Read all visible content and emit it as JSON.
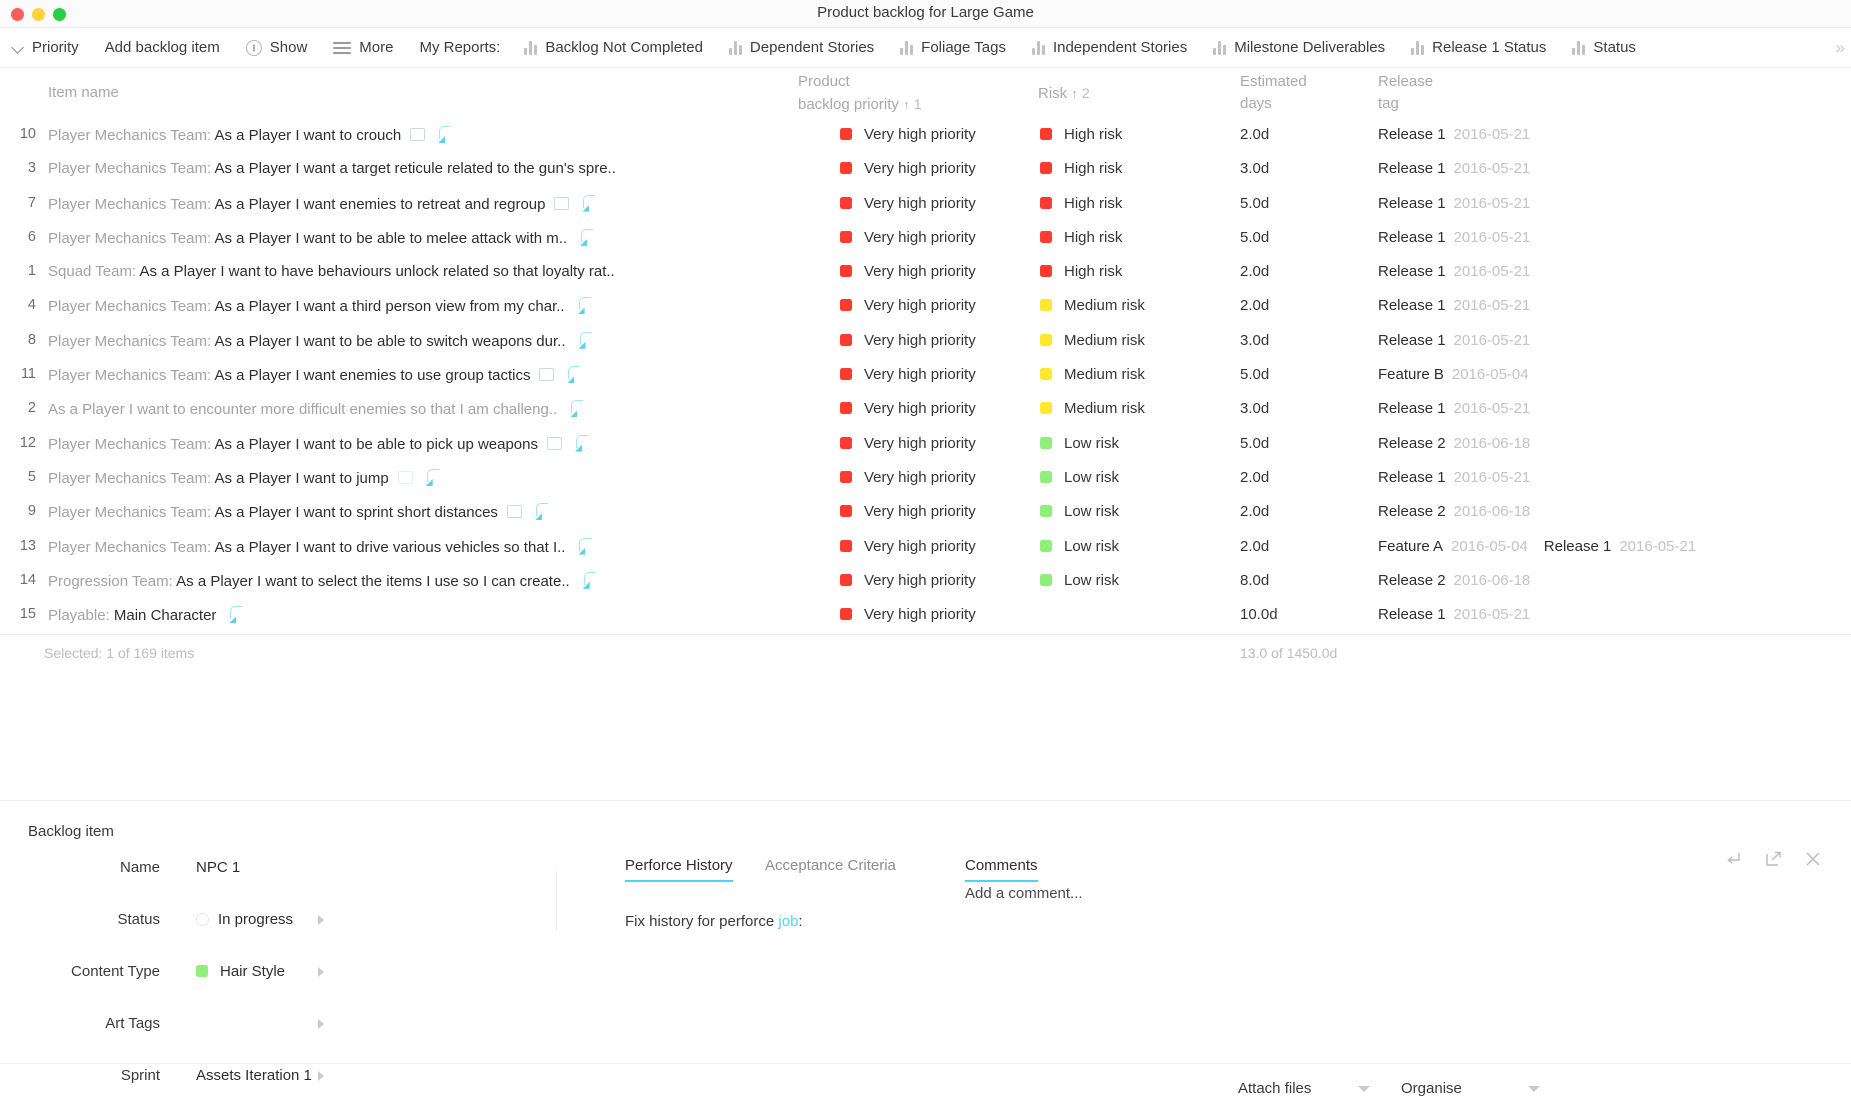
{
  "window": {
    "title": "Product backlog for Large Game",
    "traffic_lights": [
      "close",
      "minimize",
      "zoom"
    ]
  },
  "toolbar": {
    "priority_label": "Priority",
    "add_item_label": "Add backlog item",
    "show_label": "Show",
    "more_label": "More",
    "my_reports_label": "My Reports:",
    "reports": [
      "Backlog Not Completed",
      "Dependent Stories",
      "Foliage Tags",
      "Independent Stories",
      "Milestone Deliverables",
      "Release 1 Status",
      "Status"
    ],
    "overflow_label": "»"
  },
  "columns": {
    "item_name": "Item name",
    "priority_l1": "Product",
    "priority_l2": "backlog priority",
    "priority_sort": "1",
    "risk": "Risk",
    "risk_sort": "2",
    "estimated_l1": "Estimated",
    "estimated_l2": "days",
    "release_l1": "Release",
    "release_l2": "tag",
    "sort_arrow": "↑"
  },
  "colors": {
    "very_high_priority": "#ff3b2f",
    "high_risk": "#ff3b2f",
    "medium_risk": "#ffe92e",
    "low_risk": "#8ef07a",
    "accent": "#4fd3ef",
    "content_type": "#8ef07a"
  },
  "rows": [
    {
      "idx": "10",
      "team": "Player Mechanics Team:",
      "name": "As a Player I want to crouch",
      "doc": true,
      "link": true,
      "priority": "Very high priority",
      "priority_color": "#ff3b2f",
      "risk": "High risk",
      "risk_color": "#ff3b2f",
      "days": "2.0d",
      "releases": [
        {
          "tag": "Release 1",
          "date": "2016-05-21"
        }
      ]
    },
    {
      "idx": "3",
      "team": "Player Mechanics Team:",
      "name": "As a Player I want a target reticule related to the gun's spre..",
      "doc": false,
      "link": false,
      "priority": "Very high priority",
      "priority_color": "#ff3b2f",
      "risk": "High risk",
      "risk_color": "#ff3b2f",
      "days": "3.0d",
      "releases": [
        {
          "tag": "Release 1",
          "date": "2016-05-21"
        }
      ]
    },
    {
      "idx": "7",
      "team": "Player Mechanics Team:",
      "name": "As a Player I want enemies to retreat and regroup",
      "doc": true,
      "link": true,
      "priority": "Very high priority",
      "priority_color": "#ff3b2f",
      "risk": "High risk",
      "risk_color": "#ff3b2f",
      "days": "5.0d",
      "releases": [
        {
          "tag": "Release 1",
          "date": "2016-05-21"
        }
      ]
    },
    {
      "idx": "6",
      "team": "Player Mechanics Team:",
      "name": "As a Player I want to be able to melee attack with m..",
      "doc": false,
      "link": true,
      "priority": "Very high priority",
      "priority_color": "#ff3b2f",
      "risk": "High risk",
      "risk_color": "#ff3b2f",
      "days": "5.0d",
      "releases": [
        {
          "tag": "Release 1",
          "date": "2016-05-21"
        }
      ]
    },
    {
      "idx": "1",
      "team": "Squad Team:",
      "name": "As a Player I want to have behaviours unlock related so that loyalty rat..",
      "doc": false,
      "link": false,
      "priority": "Very high priority",
      "priority_color": "#ff3b2f",
      "risk": "High risk",
      "risk_color": "#ff3b2f",
      "days": "2.0d",
      "releases": [
        {
          "tag": "Release 1",
          "date": "2016-05-21"
        }
      ]
    },
    {
      "idx": "4",
      "team": "Player Mechanics Team:",
      "name": "As a Player I want a third person view from my char..",
      "doc": false,
      "link": true,
      "priority": "Very high priority",
      "priority_color": "#ff3b2f",
      "risk": "Medium risk",
      "risk_color": "#ffe92e",
      "days": "2.0d",
      "releases": [
        {
          "tag": "Release 1",
          "date": "2016-05-21"
        }
      ]
    },
    {
      "idx": "8",
      "team": "Player Mechanics Team:",
      "name": "As a Player I want to be able to switch weapons dur..",
      "doc": false,
      "link": true,
      "priority": "Very high priority",
      "priority_color": "#ff3b2f",
      "risk": "Medium risk",
      "risk_color": "#ffe92e",
      "days": "3.0d",
      "releases": [
        {
          "tag": "Release 1",
          "date": "2016-05-21"
        }
      ]
    },
    {
      "idx": "11",
      "team": "Player Mechanics Team:",
      "name": "As a Player I want enemies to use group tactics",
      "doc": true,
      "link": true,
      "priority": "Very high priority",
      "priority_color": "#ff3b2f",
      "risk": "Medium risk",
      "risk_color": "#ffe92e",
      "days": "5.0d",
      "releases": [
        {
          "tag": "Feature B",
          "date": "2016-05-04"
        }
      ]
    },
    {
      "idx": "2",
      "team": "",
      "name": "As a Player I want to encounter more difficult enemies so that I am challeng..",
      "doc": false,
      "link": true,
      "dim": true,
      "priority": "Very high priority",
      "priority_color": "#ff3b2f",
      "risk": "Medium risk",
      "risk_color": "#ffe92e",
      "days": "3.0d",
      "releases": [
        {
          "tag": "Release 1",
          "date": "2016-05-21"
        }
      ]
    },
    {
      "idx": "12",
      "team": "Player Mechanics Team:",
      "name": "As a Player I want to be able to pick up weapons",
      "doc": true,
      "link": true,
      "priority": "Very high priority",
      "priority_color": "#ff3b2f",
      "risk": "Low risk",
      "risk_color": "#8ef07a",
      "days": "5.0d",
      "releases": [
        {
          "tag": "Release 2",
          "date": "2016-06-18"
        }
      ]
    },
    {
      "idx": "5",
      "team": "Player Mechanics Team:",
      "name": "As a Player I want to jump",
      "doc": true,
      "doc_faint": true,
      "link": true,
      "priority": "Very high priority",
      "priority_color": "#ff3b2f",
      "risk": "Low risk",
      "risk_color": "#8ef07a",
      "days": "2.0d",
      "releases": [
        {
          "tag": "Release 1",
          "date": "2016-05-21"
        }
      ]
    },
    {
      "idx": "9",
      "team": "Player Mechanics Team:",
      "name": "As a Player I want to sprint short distances",
      "doc": true,
      "link": true,
      "priority": "Very high priority",
      "priority_color": "#ff3b2f",
      "risk": "Low risk",
      "risk_color": "#8ef07a",
      "days": "2.0d",
      "releases": [
        {
          "tag": "Release 2",
          "date": "2016-06-18"
        }
      ]
    },
    {
      "idx": "13",
      "team": "Player Mechanics Team:",
      "name": "As a Player I want to drive various vehicles so that I..",
      "doc": false,
      "link": true,
      "priority": "Very high priority",
      "priority_color": "#ff3b2f",
      "risk": "Low risk",
      "risk_color": "#8ef07a",
      "days": "2.0d",
      "releases": [
        {
          "tag": "Feature A",
          "date": "2016-05-04"
        },
        {
          "tag": "Release 1",
          "date": "2016-05-21"
        }
      ]
    },
    {
      "idx": "14",
      "team": "Progression Team:",
      "name": "As a Player I want to select the items I use so I can create..",
      "doc": false,
      "link": true,
      "priority": "Very high priority",
      "priority_color": "#ff3b2f",
      "risk": "Low risk",
      "risk_color": "#8ef07a",
      "days": "8.0d",
      "releases": [
        {
          "tag": "Release 2",
          "date": "2016-06-18"
        }
      ]
    },
    {
      "idx": "15",
      "team": "Playable:",
      "name": "Main Character",
      "doc": false,
      "link": true,
      "priority": "Very high priority",
      "priority_color": "#ff3b2f",
      "risk": "",
      "risk_color": "",
      "days": "10.0d",
      "releases": [
        {
          "tag": "Release 1",
          "date": "2016-05-21"
        }
      ]
    }
  ],
  "grid_footer": {
    "selection": "Selected: 1 of 169 items",
    "totals": "13.0 of 1450.0d"
  },
  "detail": {
    "title": "Backlog item",
    "fields": [
      {
        "label": "Name",
        "value": "NPC 1",
        "caret": false,
        "swatch": null,
        "spinner": false
      },
      {
        "label": "Status",
        "value": "In progress",
        "caret": true,
        "swatch": null,
        "spinner": true
      },
      {
        "label": "Content Type",
        "value": "Hair Style",
        "caret": true,
        "swatch": "#8ef07a",
        "spinner": false
      },
      {
        "label": "Art Tags",
        "value": "",
        "caret": true,
        "swatch": null,
        "spinner": false
      },
      {
        "label": "Sprint",
        "value": "Assets Iteration 1",
        "caret": true,
        "swatch": null,
        "spinner": false
      }
    ],
    "tabs": [
      {
        "label": "Perforce History",
        "active": true
      },
      {
        "label": "Acceptance Criteria",
        "active": false
      }
    ],
    "history_prefix": "Fix history for perforce ",
    "history_link": "job",
    "history_suffix": ":",
    "comments_tab": "Comments",
    "add_comment_placeholder": "Add a comment...",
    "panel_icons": [
      "return-icon",
      "expand-icon",
      "close-icon"
    ],
    "actions": {
      "attach_files": "Attach files",
      "organise": "Organise"
    }
  }
}
